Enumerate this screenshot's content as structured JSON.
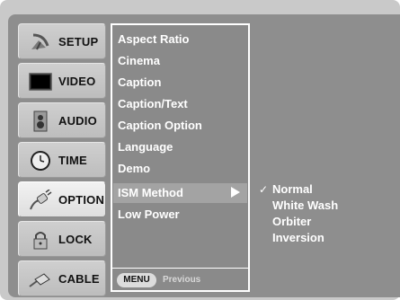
{
  "sidebar": {
    "items": [
      {
        "label": "SETUP",
        "icon": "satellite-dish-icon"
      },
      {
        "label": "VIDEO",
        "icon": "tv-screen-icon"
      },
      {
        "label": "AUDIO",
        "icon": "speaker-icon"
      },
      {
        "label": "TIME",
        "icon": "clock-icon"
      },
      {
        "label": "OPTION",
        "icon": "plug-icon",
        "active": true
      },
      {
        "label": "LOCK",
        "icon": "padlock-icon"
      },
      {
        "label": "CABLE",
        "icon": "cable-plug-icon"
      }
    ]
  },
  "menu": {
    "items": [
      "Aspect Ratio",
      "Cinema",
      "Caption",
      "Caption/Text",
      "Caption Option",
      "Language",
      "Demo",
      "ISM Method",
      "Low Power"
    ],
    "selected_index": 7,
    "footer": {
      "button_label": "MENU",
      "hint": "Previous"
    }
  },
  "submenu": {
    "items": [
      "Normal",
      "White Wash",
      "Orbiter",
      "Inversion"
    ],
    "checked_index": 0,
    "check_glyph": "✓"
  },
  "colors": {
    "panel": "#8e8e8e",
    "frame": "#c9c9c9",
    "highlight": "#a3a3a3",
    "text": "#ffffff"
  }
}
